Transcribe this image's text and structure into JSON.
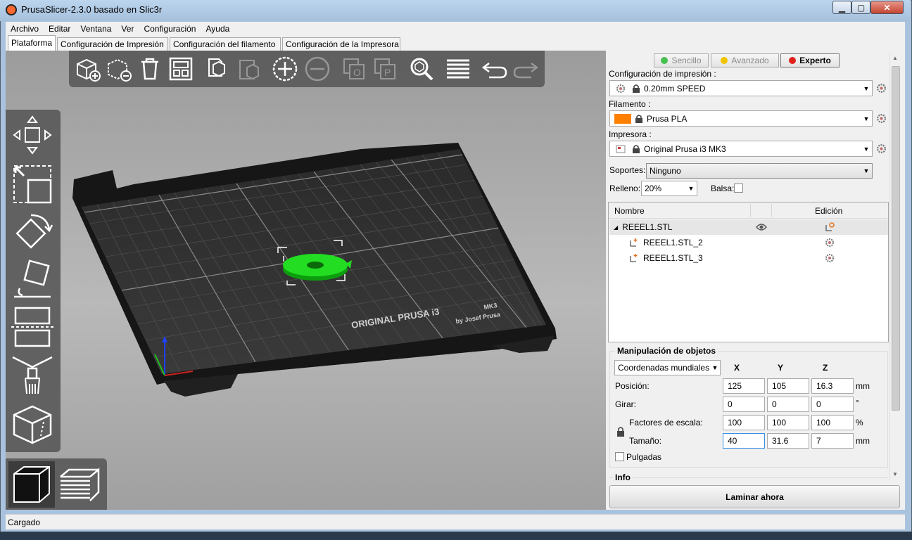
{
  "window": {
    "title": "PrusaSlicer-2.3.0 basado en Slic3r"
  },
  "menu": [
    "Archivo",
    "Editar",
    "Ventana",
    "Ver",
    "Configuración",
    "Ayuda"
  ],
  "tabs": [
    "Plataforma",
    "Configuración de Impresión",
    "Configuración del filamento",
    "Configuración de la Impresora"
  ],
  "bed": {
    "label_line1": "ORIGINAL PRUSA i3",
    "label_mk": "MK3",
    "label_line2": "by Josef Prusa"
  },
  "modes": {
    "simple": {
      "label": "Sencillo",
      "color": "#46c04f"
    },
    "advanced": {
      "label": "Avanzado",
      "color": "#f0c400"
    },
    "expert": {
      "label": "Experto",
      "color": "#e0201b"
    }
  },
  "print_settings": {
    "label": "Configuración de impresión :",
    "value": "0.20mm SPEED"
  },
  "filament": {
    "label": "Filamento :",
    "value": "Prusa PLA",
    "color": "#ff8000"
  },
  "printer": {
    "label": "Impresora :",
    "value": "Original Prusa i3 MK3"
  },
  "supports": {
    "label": "Soportes:",
    "value": "Ninguno"
  },
  "infill": {
    "label": "Relleno:",
    "value": "20%"
  },
  "brim": {
    "label": "Balsa:"
  },
  "object_list": {
    "col_name": "Nombre",
    "col_edit": "Edición",
    "items": [
      {
        "name": "REEEL1.STL"
      },
      {
        "name": "REEEL1.STL_2"
      },
      {
        "name": "REEEL1.STL_3"
      }
    ]
  },
  "manipulation": {
    "title": "Manipulación de objetos",
    "coords": "Coordenadas mundiales",
    "axes": [
      "X",
      "Y",
      "Z"
    ],
    "position": {
      "label": "Posición:",
      "x": "125",
      "y": "105",
      "z": "16.3",
      "unit": "mm"
    },
    "rotation": {
      "label": "Girar:",
      "x": "0",
      "y": "0",
      "z": "0",
      "unit": "°"
    },
    "scale": {
      "label": "Factores de escala:",
      "x": "100",
      "y": "100",
      "z": "100",
      "unit": "%"
    },
    "size": {
      "label": "Tamaño:",
      "x": "40",
      "y": "31.6",
      "z": "7",
      "unit": "mm"
    },
    "inches": "Pulgadas"
  },
  "info": {
    "title": "Info"
  },
  "slice_button": "Laminar ahora",
  "status": "Cargado"
}
